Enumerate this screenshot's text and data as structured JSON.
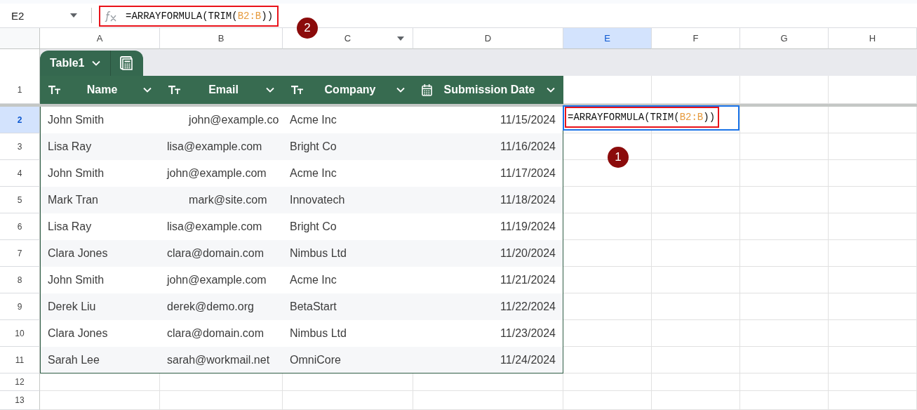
{
  "formula_bar": {
    "cell_reference": "E2",
    "formula": [
      {
        "text": "=ARRAYFORMULA(TRIM(",
        "kind": "plain"
      },
      {
        "text": "B2:B",
        "kind": "range"
      },
      {
        "text": "))",
        "kind": "plain"
      }
    ]
  },
  "columns": [
    {
      "label": "A",
      "selected": false,
      "menu": false
    },
    {
      "label": "B",
      "selected": false,
      "menu": false
    },
    {
      "label": "C",
      "selected": false,
      "menu": true
    },
    {
      "label": "D",
      "selected": false,
      "menu": false
    },
    {
      "label": "E",
      "selected": true,
      "menu": false
    },
    {
      "label": "F",
      "selected": false,
      "menu": false
    },
    {
      "label": "G",
      "selected": false,
      "menu": false
    },
    {
      "label": "H",
      "selected": false,
      "menu": false
    }
  ],
  "table": {
    "name": "Table1",
    "header_row_number": "1",
    "headers": [
      {
        "label": "Name",
        "kind": "text"
      },
      {
        "label": "Email",
        "kind": "text"
      },
      {
        "label": "Company",
        "kind": "text"
      },
      {
        "label": "Submission Date",
        "kind": "date"
      }
    ],
    "rows": [
      {
        "number": "2",
        "selected": true,
        "cells": [
          "John Smith",
          "       john@example.co",
          "Acme Inc",
          "11/15/2024"
        ]
      },
      {
        "number": "3",
        "selected": false,
        "cells": [
          "Lisa Ray",
          "lisa@example.com",
          "Bright Co",
          "11/16/2024"
        ]
      },
      {
        "number": "4",
        "selected": false,
        "cells": [
          "John Smith",
          "john@example.com",
          "Acme Inc",
          "11/17/2024"
        ]
      },
      {
        "number": "5",
        "selected": false,
        "cells": [
          "Mark Tran",
          "       mark@site.com",
          "Innovatech",
          "11/18/2024"
        ]
      },
      {
        "number": "6",
        "selected": false,
        "cells": [
          "Lisa Ray",
          "lisa@example.com",
          "Bright Co",
          "11/19/2024"
        ]
      },
      {
        "number": "7",
        "selected": false,
        "cells": [
          "Clara Jones",
          "clara@domain.com",
          "Nimbus Ltd",
          "11/20/2024"
        ]
      },
      {
        "number": "8",
        "selected": false,
        "cells": [
          "John Smith",
          "john@example.com",
          "Acme Inc",
          "11/21/2024"
        ]
      },
      {
        "number": "9",
        "selected": false,
        "cells": [
          "Derek Liu",
          "derek@demo.org",
          "BetaStart",
          "11/22/2024"
        ]
      },
      {
        "number": "10",
        "selected": false,
        "cells": [
          "Clara Jones",
          "clara@domain.com",
          "Nimbus Ltd",
          "11/23/2024"
        ]
      },
      {
        "number": "11",
        "selected": false,
        "cells": [
          "Sarah Lee",
          "sarah@workmail.net",
          "OmniCore",
          "11/24/2024"
        ]
      }
    ]
  },
  "active_cell": {
    "formula": [
      {
        "text": "=ARRAYFORMULA(TRIM(",
        "kind": "plain"
      },
      {
        "text": "B2:B",
        "kind": "range"
      },
      {
        "text": "))",
        "kind": "plain"
      }
    ]
  },
  "empty_rows": [
    "12",
    "13"
  ],
  "callouts": [
    "1",
    "2"
  ]
}
